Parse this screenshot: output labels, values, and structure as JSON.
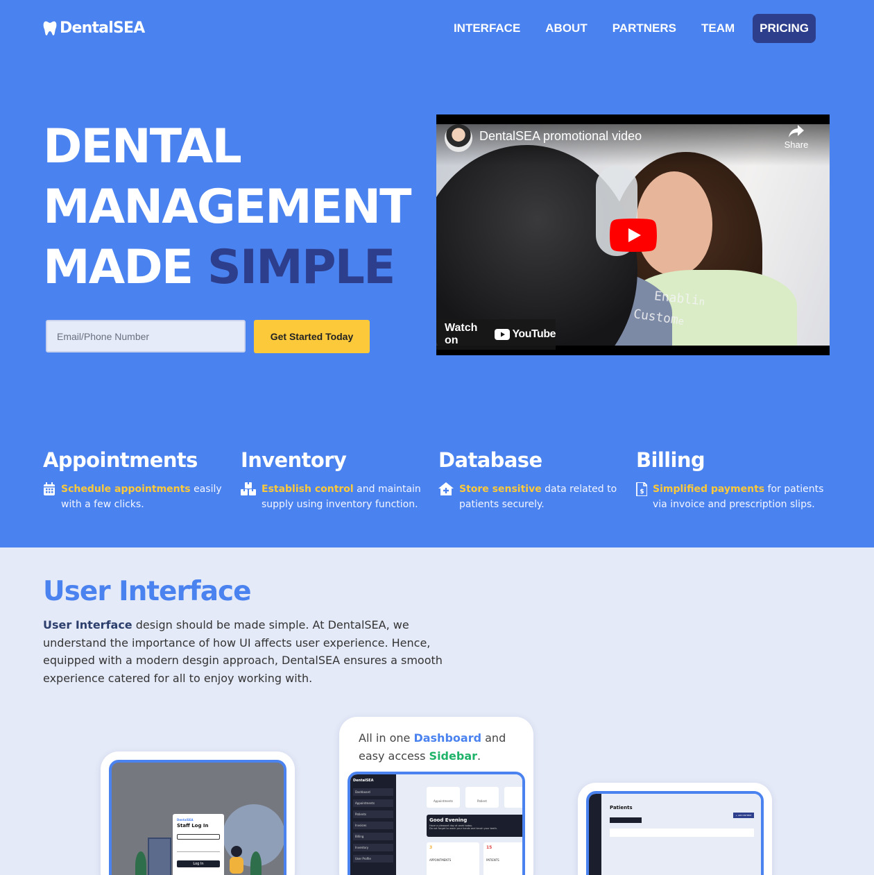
{
  "brand": {
    "name": "DentalSEA"
  },
  "nav": {
    "items": [
      {
        "label": "INTERFACE"
      },
      {
        "label": "ABOUT"
      },
      {
        "label": "PARTNERS"
      },
      {
        "label": "TEAM"
      }
    ],
    "pricing_label": "PRICING"
  },
  "hero": {
    "line1": "DENTAL",
    "line2": "MANAGEMENT",
    "line3_a": "MADE",
    "line3_b": "SIMPLE",
    "email_placeholder": "Email/Phone Number",
    "cta_label": "Get Started Today"
  },
  "video": {
    "title": "DentalSEA promotional video",
    "share_label": "Share",
    "watch_label": "Watch on",
    "yt_label": "YouTube",
    "overlay_line1": "Enabli",
    "overlay_line1b": "n",
    "overlay_line2": "Custom",
    "overlay_line2b": "e"
  },
  "features": [
    {
      "title": "Appointments",
      "highlight": "Schedule appointments",
      "rest": " easily with a few clicks.",
      "icon": "calendar-icon"
    },
    {
      "title": "Inventory",
      "highlight": "Establish control",
      "rest": " and maintain supply using inventory function.",
      "icon": "boxes-icon"
    },
    {
      "title": "Database",
      "highlight": "Store sensitive",
      "rest": " data related to patients securely.",
      "icon": "secure-home-icon"
    },
    {
      "title": "Billing",
      "highlight": "Simplified payments",
      "rest": " for patients via invoice and prescription slips.",
      "icon": "invoice-icon"
    }
  ],
  "ui_section": {
    "title": "User Interface",
    "desc_bold": "User Interface",
    "desc_rest": " design should be made simple. At DentalSEA, we understand the importance of how UI affects user experience. Hence, equipped with a modern desgin approach, DentalSEA ensures a smooth experience catered for all to enjoy working with.",
    "card2_caption_a": "All in one ",
    "card2_caption_b": "Dashboard",
    "card2_caption_c": " and easy access ",
    "card2_caption_d": "Sidebar",
    "card2_caption_e": "."
  },
  "mock_login": {
    "brand": "DentalSEA",
    "title": "Staff Log In",
    "button": "Log In"
  },
  "mock_dashboard": {
    "brand": "DentalSEA",
    "sidebar": [
      "Dashboard",
      "Appointments",
      "Patients",
      "Invoices",
      "Billing",
      "Inventory",
      "User Profile"
    ],
    "greeting": "Good Evening",
    "greeting_sub": "Have a pleasant day at work today.",
    "greeting_sub2": "Do not forget to wash your hands and brush your teeth.",
    "tiles": [
      "Appointments",
      "Patient"
    ],
    "stat1_num": "3",
    "stat1_label": "APPOINTMENTS",
    "stat2_num": "15",
    "stat2_label": "PATIENTS"
  },
  "mock_patients": {
    "title": "Patients",
    "add_button": "+ ADD PATIENT"
  },
  "colors": {
    "hero_blue": "#4a82ef",
    "navy": "#2c3e8c",
    "yellow": "#fcc93a",
    "green": "#1fb36a"
  }
}
